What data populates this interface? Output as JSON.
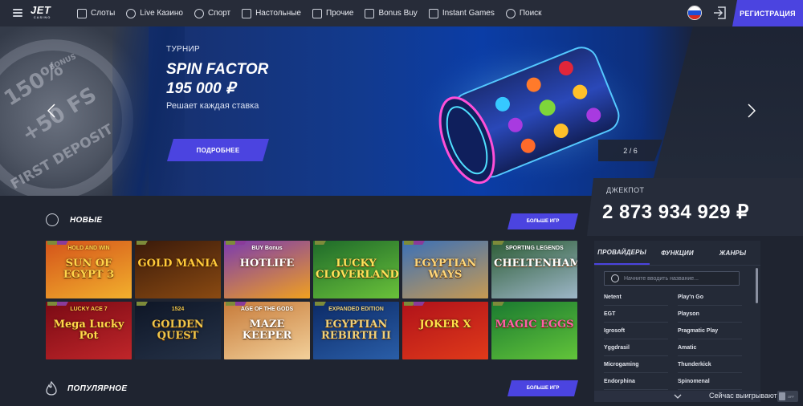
{
  "header": {
    "logo": "JET",
    "logo_sub": "CASINO",
    "nav": [
      {
        "label": "Слоты",
        "icon": "slots-icon"
      },
      {
        "label": "Live Казино",
        "icon": "live-casino-icon"
      },
      {
        "label": "Спорт",
        "icon": "sport-icon"
      },
      {
        "label": "Настольные",
        "icon": "table-games-icon"
      },
      {
        "label": "Прочие",
        "icon": "other-games-icon"
      },
      {
        "label": "Bonus Buy",
        "icon": "bonus-buy-icon"
      },
      {
        "label": "Instant Games",
        "icon": "instant-games-icon"
      },
      {
        "label": "Поиск",
        "icon": "search-icon"
      }
    ],
    "register": "РЕГИСТРАЦИЯ"
  },
  "banner": {
    "side_text": [
      "BONUS",
      "150%",
      "+50 FS",
      "FIRST DEPOSIT"
    ],
    "label": "ТУРНИР",
    "title": "SPIN FACTOR",
    "amount": "195 000 ₽",
    "subtitle": "Решает каждая ставка",
    "button": "ПОДРОБНЕЕ",
    "counter": "2 / 6"
  },
  "jackpot": {
    "label": "ДЖЕКПОТ",
    "value": "2 873 934 929 ₽"
  },
  "sections": {
    "new": {
      "title": "НОВЫЕ",
      "more": "БОЛЬШЕ ИГР"
    },
    "popular": {
      "title": "ПОПУЛЯРНОЕ",
      "more": "БОЛЬШЕ ИГР"
    }
  },
  "games": [
    {
      "name": "SUN OF EGYPT 3",
      "sub": "HOLD AND WIN",
      "c1": "#d4531a",
      "c2": "#f2b02d",
      "text": "#ffd54a"
    },
    {
      "name": "GOLD MANIA",
      "sub": "",
      "c1": "#3a1a0a",
      "c2": "#8a4a12",
      "text": "#ffcb3a"
    },
    {
      "name": "HOTLIFE",
      "sub": "BUY Bonus",
      "c1": "#7a3ab0",
      "c2": "#f0a020",
      "text": "#ffffff"
    },
    {
      "name": "LUCKY CLOVERLAND",
      "sub": "",
      "c1": "#1e6a2a",
      "c2": "#6ac23a",
      "text": "#ffe35a"
    },
    {
      "name": "EGYPTIAN WAYS",
      "sub": "",
      "c1": "#3a70b8",
      "c2": "#c79a52",
      "text": "#ffd77a"
    },
    {
      "name": "CHELTENHAM",
      "sub": "SPORTING LEGENDS",
      "c1": "#2c5c34",
      "c2": "#9db6c8",
      "text": "#ffffff"
    },
    {
      "name": "Mega Lucky Pot",
      "sub": "LUCKY ACE 7",
      "c1": "#7a0a14",
      "c2": "#c0262a",
      "text": "#ffd84a"
    },
    {
      "name": "GOLDEN QUEST",
      "sub": "1524",
      "c1": "#0e1626",
      "c2": "#253248",
      "text": "#f0c64a"
    },
    {
      "name": "MAZE KEEPER",
      "sub": "AGE OF THE GODS",
      "c1": "#c77b3a",
      "c2": "#f2d09a",
      "text": "#ffffff"
    },
    {
      "name": "EGYPTIAN REBIRTH II",
      "sub": "EXPANDED EDITION",
      "c1": "#0c2a66",
      "c2": "#2a5ea8",
      "text": "#f0d27a"
    },
    {
      "name": "JOKER X",
      "sub": "",
      "c1": "#b0121a",
      "c2": "#e03a1a",
      "text": "#ffe14a"
    },
    {
      "name": "MAGIC EGGS",
      "sub": "",
      "c1": "#1a7a30",
      "c2": "#62c43a",
      "text": "#ff5fa8"
    }
  ],
  "providers": {
    "tabs": [
      "ПРОВАЙДЕРЫ",
      "ФУНКЦИИ",
      "ЖАНРЫ"
    ],
    "search_placeholder": "Начните вводить название...",
    "list": [
      [
        "Netent",
        "Play'n Go"
      ],
      [
        "EGT",
        "Playson"
      ],
      [
        "Igrosoft",
        "Pragmatic Play"
      ],
      [
        "Yggdrasil",
        "Amatic"
      ],
      [
        "Microgaming",
        "Thunderkick"
      ],
      [
        "Endorphina",
        "Spinomenal"
      ]
    ]
  },
  "footer": {
    "winning": "Сейчас выигрывают",
    "toggle": "OFF"
  },
  "colors": {
    "accent": "#4b44e0",
    "background": "#1f2430",
    "header": "#272c39"
  }
}
